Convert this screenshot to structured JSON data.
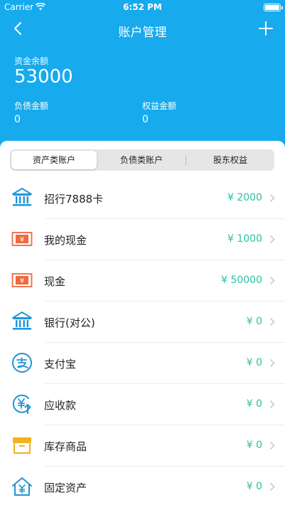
{
  "status_bar": {
    "carrier": "Carrier",
    "time": "6:52 PM"
  },
  "nav": {
    "title": "账户管理"
  },
  "summary": {
    "balance_label": "资金余额",
    "balance_value": "53000",
    "debt_label": "负债金额",
    "debt_value": "0",
    "equity_label": "权益金额",
    "equity_value": "0"
  },
  "tabs": [
    {
      "label": "资产类账户",
      "active": true
    },
    {
      "label": "负债类账户",
      "active": false
    },
    {
      "label": "股东权益",
      "active": false
    }
  ],
  "accounts": [
    {
      "name": "招行7888卡",
      "amount": "¥ 2000",
      "icon": "bank-icon"
    },
    {
      "name": "我的现金",
      "amount": "¥ 1000",
      "icon": "cash-icon"
    },
    {
      "name": "现金",
      "amount": "¥ 50000",
      "icon": "cash-icon"
    },
    {
      "name": "银行(对公)",
      "amount": "¥ 0",
      "icon": "bank-icon"
    },
    {
      "name": "支付宝",
      "amount": "¥ 0",
      "icon": "alipay-icon"
    },
    {
      "name": "应收款",
      "amount": "¥ 0",
      "icon": "receivable-icon"
    },
    {
      "name": "库存商品",
      "amount": "¥ 0",
      "icon": "inventory-box-icon"
    },
    {
      "name": "固定资产",
      "amount": "¥ 0",
      "icon": "fixed-asset-house-icon"
    }
  ],
  "colors": {
    "header": "#17aaed",
    "amount": "#2bbfa3",
    "bank_icon": "#1f95d8",
    "cash_icon": "#ef6a3e",
    "inventory_icon": "#f1b21c"
  }
}
